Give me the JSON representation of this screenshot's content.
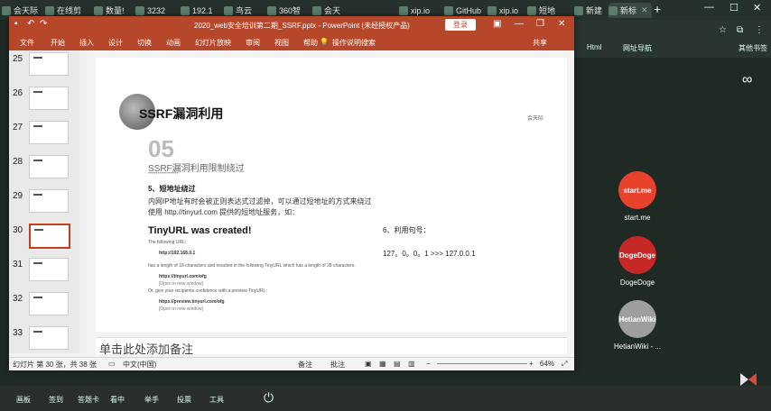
{
  "browser": {
    "tabs": [
      {
        "label": "会天际"
      },
      {
        "label": "在线剪"
      },
      {
        "label": "数量!"
      },
      {
        "label": "3232"
      },
      {
        "label": "192.1"
      },
      {
        "label": "鸟云"
      },
      {
        "label": "360智"
      },
      {
        "label": "会天"
      },
      {
        "label": "xip.io"
      },
      {
        "label": "GitHub"
      },
      {
        "label": "会天"
      },
      {
        "label": "xip.io"
      },
      {
        "label": "短地"
      },
      {
        "label": "新建"
      },
      {
        "label": "新标"
      }
    ],
    "new_tab": "+",
    "bookmarks": [
      "Html",
      "网址导航",
      "其他书签"
    ]
  },
  "ppt": {
    "title": "2020_web安全培训第二期_SSRF.pptx - PowerPoint (未经授权产品)",
    "login_label": "登录",
    "ribbon_tabs": [
      "文件",
      "开始",
      "插入",
      "设计",
      "切换",
      "动画",
      "幻灯片放映",
      "审阅",
      "视图",
      "帮助",
      "操作说明搜索"
    ],
    "share_label": "共享",
    "thumbnails": [
      {
        "num": "25"
      },
      {
        "num": "26"
      },
      {
        "num": "27"
      },
      {
        "num": "28"
      },
      {
        "num": "29"
      },
      {
        "num": "30"
      },
      {
        "num": "31"
      },
      {
        "num": "32"
      },
      {
        "num": "33"
      }
    ],
    "notes_placeholder": "单击此处添加备注",
    "status": {
      "slide_info": "幻灯片 第 30 张，共 38 张",
      "language": "中文(中国)",
      "notes_btn": "备注",
      "comments_btn": "批注",
      "zoom": "64%"
    }
  },
  "slide": {
    "title": "SSRF漏洞利用",
    "section_number": "05",
    "subtitle": "SSRF漏洞利用限制绕过",
    "dots": "••••••••••••••••",
    "heading": "5、短地址绕过",
    "para1": "内网IP地址有时会被正则表达式过滤掉，可以通过短地址的方式来绕过",
    "para2": "使用 http://tinyurl.com 提供的短地址服务，如：",
    "tinyurl_heading": "TinyURL was created!",
    "hint_label": "6、利用句号：",
    "following_url": "The following URL:",
    "ip_url": "http://192.168.0.1",
    "ip_result": "127。0。0。1 >>> 127.0.0.1",
    "length_note": "has a length of 18 characters and resulted in the following TinyURL which has a length of 28 characters:",
    "link1": "https://tinyurl.com/ofg",
    "open_window_1": "[Open in new window]",
    "preview_note": "Or, give your recipients confidence with a preview TinyURL:",
    "link2": "https://preview.tinyurl.com/ofg",
    "open_window_2": "[Open in new window]",
    "logo_text": "会天际"
  },
  "desktop": {
    "icons": [
      {
        "label": "start.me",
        "badge": "start.me",
        "color": "#e8412c"
      },
      {
        "label": "DogeDoge",
        "badge": "DogeDoge",
        "color": "#c62828"
      },
      {
        "label": "HetianWiki - ...",
        "badge": "HetianWiki",
        "color": "#9e9e9e"
      }
    ],
    "infinity": "∞"
  },
  "taskbar": {
    "items": [
      "画板",
      "签到",
      "答题卡",
      "看中",
      "举手",
      "投票",
      "工具"
    ]
  }
}
